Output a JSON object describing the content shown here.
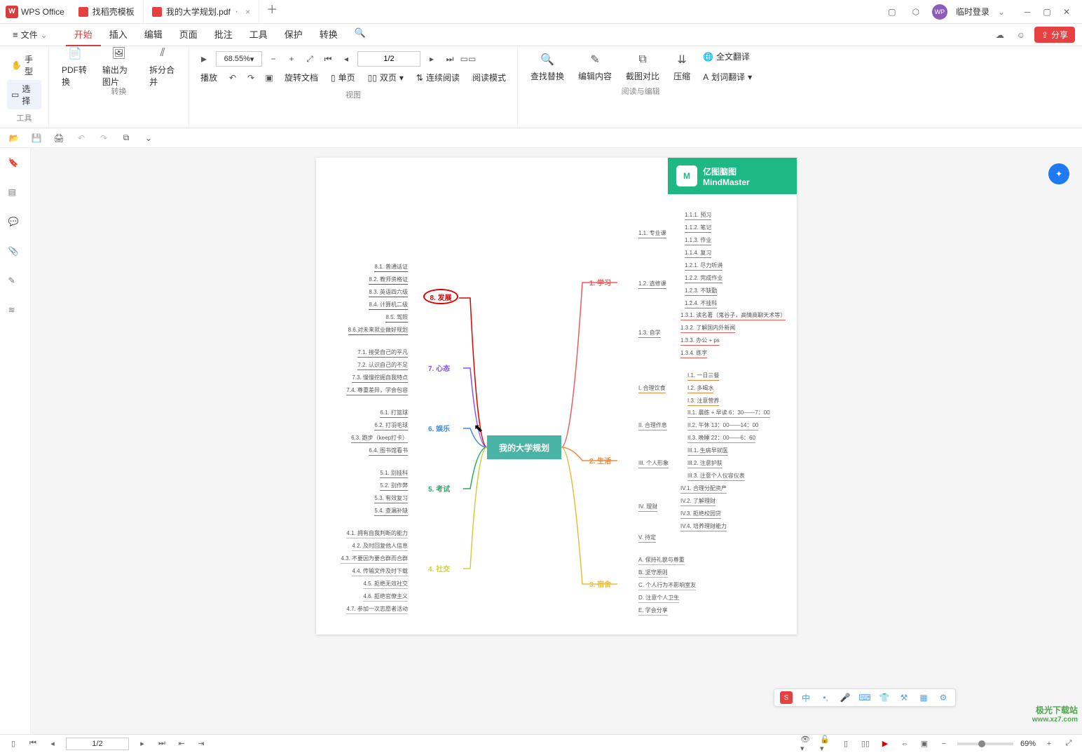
{
  "app": {
    "name": "WPS Office"
  },
  "tabs": [
    {
      "icon": "dk",
      "label": "找稻壳模板"
    },
    {
      "icon": "pdf",
      "label": "我的大学规划.pdf",
      "active": true,
      "modified": true
    }
  ],
  "titlebar_right": {
    "login_label": "临时登录"
  },
  "menu": {
    "file_label": "文件",
    "items": [
      "开始",
      "插入",
      "编辑",
      "页面",
      "批注",
      "工具",
      "保护",
      "转换"
    ]
  },
  "ribbon": {
    "tools": {
      "hand": "手型",
      "select": "选择",
      "group": "工具"
    },
    "convert": {
      "pdf": "PDF转换",
      "img": "输出为图片",
      "split": "拆分合并",
      "group": "转换"
    },
    "view": {
      "play": "播放",
      "zoom": "68.55%",
      "page": "1/2",
      "rotate": "旋转文档",
      "single": "单页",
      "double": "双页",
      "cont": "连续阅读",
      "mode": "阅读模式",
      "group": "视图"
    },
    "edit": {
      "find": "查找替换",
      "editc": "编辑内容",
      "compare": "截图对比",
      "compress": "压缩",
      "fulltrans": "全文翻译",
      "wordtrans": "划词翻译",
      "group": "阅读与编辑"
    }
  },
  "pdf": {
    "brand1": "亿图脑图",
    "brand2": "MindMaster",
    "center": "我的大学规划",
    "redNode": "8. 发展",
    "left": {
      "n8": [
        "8.1. 普通话证",
        "8.2. 教师资格证",
        "8.3. 英语四六级",
        "8.4. 计算机二级",
        "8.5. 驾照",
        "8.6.对未来就业做好规划"
      ],
      "n7t": "7. 心态",
      "n7": [
        "7.1. 接受自己的平凡",
        "7.2. 认识自己的不足",
        "7.3. 慢慢挖掘自我特点",
        "7.4. 尊重差异，学会包容"
      ],
      "n6t": "6. 娱乐",
      "n6": [
        "6.1. 打篮球",
        "6.2. 打羽毛球",
        "6.3. 跑步（keep打卡）",
        "6.4. 图书馆看书"
      ],
      "n5t": "5. 考试",
      "n5": [
        "5.1. 别挂科",
        "5.2. 别作弊",
        "5.3. 有效复习",
        "5.4. 查漏补缺"
      ],
      "n4t": "4. 社交",
      "n4": [
        "4.1. 拥有自我判断的能力",
        "4.2. 及时回复他人信息",
        "4.3. 不要因为要合群而合群",
        "4.4. 传输文件及时下载",
        "4.5. 拒绝无效社交",
        "4.6. 拒绝官僚主义",
        "4.7. 参加一次志愿者活动"
      ]
    },
    "right": {
      "n1t": "1. 学习",
      "n1a": "1.1. 专业课",
      "n1a_s": [
        "1.1.1. 预习",
        "1.1.2. 笔记",
        "1.1.3. 作业",
        "1.1.4. 复习"
      ],
      "n1b": "1.2. 选修课",
      "n1b_s": [
        "1.2.1. 尽力听讲",
        "1.2.2. 完成作业",
        "1.2.3. 不缺勤",
        "1.2.4. 不挂科"
      ],
      "n1c": "1.3. 自学",
      "n1c_s": [
        "1.3.1. 读名著（鬼谷子，高情商聊天术等）",
        "1.3.2. 了解国内外新闻",
        "1.3.3. 办公 + ps",
        "1.3.4. 练字"
      ],
      "n2t": "2. 生活",
      "n2a": "I. 合理饮食",
      "n2a_s": [
        "I.1. 一日三餐",
        "I.2. 多喝水",
        "I.3. 注意营养"
      ],
      "n2b": "II. 合理作息",
      "n2b_s": [
        "II.1. 晨练 + 早读 6：30——7：00",
        "II.2. 午休 13：00——14：00",
        "II.3. 晚睡 22：00——6：60"
      ],
      "n2c": "III. 个人形象",
      "n2c_s": [
        "III.1. 生病早就医",
        "III.2. 注意护肤",
        "III.3. 注意个人仪容仪表"
      ],
      "n2d": "IV. 理财",
      "n2d_s": [
        "IV.1. 合理分配资产",
        "IV.2. 了解理财",
        "IV.3. 拒绝校园贷",
        "IV.4. 培养理财能力"
      ],
      "n2e": "V. 待定",
      "n3t": "3. 宿舍",
      "n3": [
        "A. 保持礼貌与尊重",
        "B. 坚守原则",
        "C. 个人行为不影响室友",
        "D. 注意个人卫生",
        "E. 学会分享"
      ]
    }
  },
  "statusbar": {
    "page": "1/2",
    "zoom": "69%"
  },
  "ime": {
    "lang": "中"
  },
  "wm": {
    "line1": "极光下载站",
    "line2": "www.xz7.com"
  }
}
